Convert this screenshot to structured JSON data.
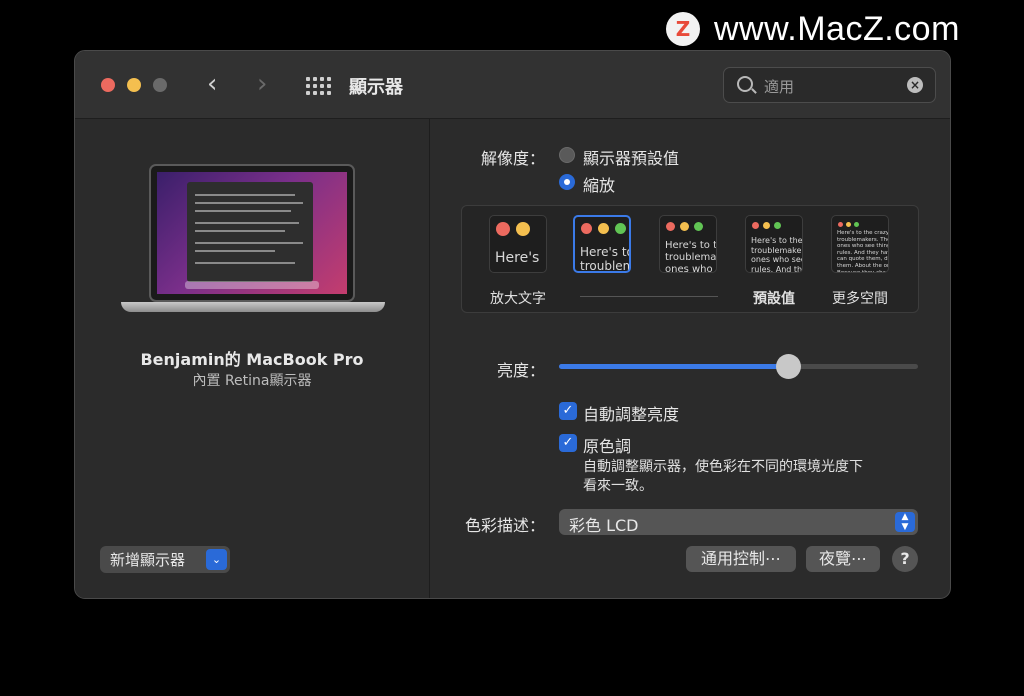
{
  "watermark": {
    "logo_letter": "Z",
    "text": "www.MacZ.com"
  },
  "window": {
    "title": "顯示器"
  },
  "search": {
    "value": "適用"
  },
  "device": {
    "name": "Benjamin的 MacBook Pro",
    "subtitle": "內置 Retina顯示器"
  },
  "add_display": {
    "label": "新增顯示器"
  },
  "resolution": {
    "label": "解像度：",
    "options": [
      {
        "label": "顯示器預設值",
        "selected": false
      },
      {
        "label": "縮放",
        "selected": true
      }
    ]
  },
  "scale_options": [
    {
      "preview": "Here's",
      "label": "放大文字",
      "selected": false
    },
    {
      "preview": "Here's to\ntroublem",
      "label": "",
      "selected": true
    },
    {
      "preview": "Here's to t\ntroublema\nones who",
      "label": "",
      "selected": false
    },
    {
      "preview": "Here's to the cr\ntroublemakers.\nones who see t\nrules. And they",
      "label": "預設值",
      "selected": false
    },
    {
      "preview": "Here's to the crazy one\ntroublemakers. The rou\nones who see things diff\nrules. And they have no\ncan quote them, disagre\nthem. About the only th\nBecause they change th",
      "label": "更多空間",
      "selected": false
    }
  ],
  "brightness": {
    "label": "亮度：",
    "value": 0.64
  },
  "auto_brightness": {
    "label": "自動調整亮度",
    "checked": true
  },
  "true_tone": {
    "label": "原色調",
    "checked": true,
    "description_line1": "自動調整顯示器，使色彩在不同的環境光度下",
    "description_line2": "看來一致。"
  },
  "color_profile": {
    "label": "色彩描述：",
    "value": "彩色 LCD"
  },
  "buttons": {
    "universal_control": "通用控制⋯",
    "night_shift": "夜覽⋯",
    "help": "?"
  },
  "colors": {
    "accent": "#2a6ad8",
    "close": "#ec6a5f",
    "minimize": "#f4bf4f",
    "zoom": "#6a6a6a"
  }
}
